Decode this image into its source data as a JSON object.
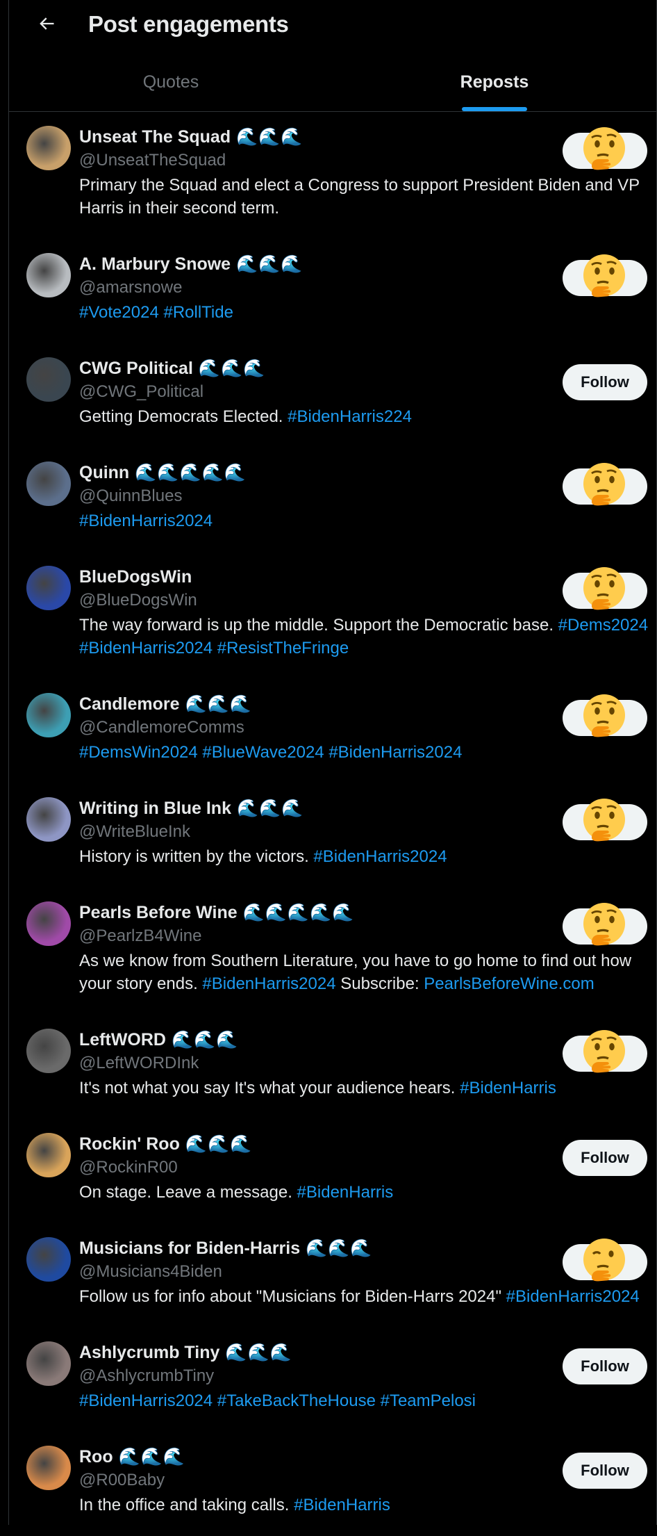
{
  "header": {
    "title": "Post engagements"
  },
  "tabs": [
    {
      "label": "Quotes"
    },
    {
      "label": "Reposts"
    }
  ],
  "users": [
    {
      "name": "Unseat The Squad",
      "waves": "🌊🌊🌊",
      "handle": "@UnseatTheSquad",
      "bio": [
        [
          "Primary the Squad and elect a Congress to support President Biden and VP Harris in their second term.",
          false
        ]
      ],
      "action": "emoji",
      "avatar_color": "#c8a06a"
    },
    {
      "name": "A. Marbury Snowe",
      "waves": "🌊🌊🌊",
      "handle": "@amarsnowe",
      "bio": [
        [
          "#Vote2024",
          true
        ],
        [
          " ",
          false
        ],
        [
          "#RollTide",
          true
        ]
      ],
      "action": "emoji",
      "avatar_color": "#b8bcc0"
    },
    {
      "name": "CWG Political",
      "waves": "🌊🌊🌊",
      "handle": "@CWG_Political",
      "bio": [
        [
          "Getting Democrats Elected. ",
          false
        ],
        [
          "#BidenHarris224",
          true
        ]
      ],
      "action": "follow",
      "follow_label": "Follow",
      "avatar_color": "#3a4650"
    },
    {
      "name": "Quinn",
      "waves": "🌊🌊🌊🌊🌊",
      "handle": "@QuinnBlues",
      "bio": [
        [
          "#BidenHarris2024",
          true
        ]
      ],
      "action": "emoji",
      "avatar_color": "#5c6f8c"
    },
    {
      "name": "BlueDogsWin",
      "waves": "",
      "handle": "@BlueDogsWin",
      "bio": [
        [
          "The way forward is up the middle. Support the Democratic base. ",
          false
        ],
        [
          "#Dems2024",
          true
        ],
        [
          " ",
          false
        ],
        [
          "#BidenHarris2024",
          true
        ],
        [
          " ",
          false
        ],
        [
          "#ResistTheFringe",
          true
        ]
      ],
      "action": "emoji",
      "avatar_color": "#2a48a8"
    },
    {
      "name": "Candlemore",
      "waves": "🌊🌊🌊",
      "handle": "@CandlemoreComms",
      "bio": [
        [
          "#DemsWin2024",
          true
        ],
        [
          " ",
          false
        ],
        [
          "#BlueWave2024",
          true
        ],
        [
          " ",
          false
        ],
        [
          "#BidenHarris2024",
          true
        ]
      ],
      "action": "emoji",
      "avatar_color": "#3d9fb4"
    },
    {
      "name": "Writing in Blue Ink",
      "waves": "🌊🌊🌊",
      "handle": "@WriteBlueInk",
      "bio": [
        [
          "History is written by the victors. ",
          false
        ],
        [
          "#BidenHarris2024",
          true
        ]
      ],
      "action": "emoji",
      "avatar_color": "#8e96c4"
    },
    {
      "name": "Pearls Before Wine",
      "waves": "🌊🌊🌊🌊🌊",
      "handle": "@PearlzB4Wine",
      "bio": [
        [
          "As we know from Southern Literature, you have to go home to find out how your story ends. ",
          false
        ],
        [
          "#BidenHarris2024",
          true
        ],
        [
          " Subscribe: ",
          false
        ],
        [
          "PearlsBeforeWine.com",
          true
        ]
      ],
      "action": "emoji",
      "avatar_color": "#a04aa8"
    },
    {
      "name": "LeftWORD",
      "waves": "🌊🌊🌊",
      "handle": "@LeftWORDInk",
      "bio": [
        [
          "It's not what you say It's what your audience hears. ",
          false
        ],
        [
          "#BidenHarris",
          true
        ]
      ],
      "action": "emoji",
      "avatar_color": "#6a6a6a"
    },
    {
      "name": "Rockin' Roo",
      "waves": "🌊🌊🌊",
      "handle": "@RockinR00",
      "bio": [
        [
          "On stage. Leave a message. ",
          false
        ],
        [
          "#BidenHarris",
          true
        ]
      ],
      "action": "follow",
      "follow_label": "Follow",
      "avatar_color": "#d9a45a"
    },
    {
      "name": "Musicians for Biden-Harris",
      "waves": "🌊🌊🌊",
      "handle": "@Musicians4Biden",
      "bio": [
        [
          "Follow us for info about \"Musicians for Biden-Harrs 2024\" ",
          false
        ],
        [
          "#BidenHarris2024",
          true
        ]
      ],
      "action": "emoji-wink",
      "avatar_color": "#1f4aa0"
    },
    {
      "name": "Ashlycrumb Tiny",
      "waves": "🌊🌊🌊",
      "handle": "@AshlycrumbTiny",
      "bio": [
        [
          "#BidenHarris2024",
          true
        ],
        [
          " ",
          false
        ],
        [
          "#TakeBackTheHouse",
          true
        ],
        [
          " ",
          false
        ],
        [
          "#TeamPelosi",
          true
        ]
      ],
      "action": "follow",
      "follow_label": "Follow",
      "avatar_color": "#8a7a78"
    },
    {
      "name": "Roo",
      "waves": "🌊🌊🌊",
      "handle": "@R00Baby",
      "bio": [
        [
          "In the office and taking calls. ",
          false
        ],
        [
          "#BidenHarris",
          true
        ]
      ],
      "action": "follow",
      "follow_label": "Follow",
      "avatar_color": "#d98a4a"
    }
  ],
  "colors": {
    "accent": "#1d9bf0",
    "muted": "#71767b",
    "background": "#000000",
    "text": "#e7e9ea"
  }
}
